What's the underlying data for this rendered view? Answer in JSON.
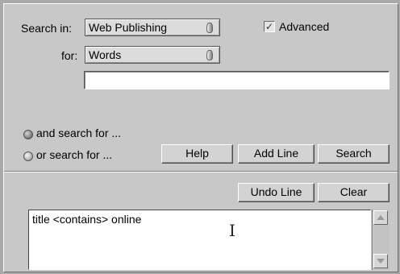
{
  "search": {
    "search_in_label": "Search in:",
    "search_in_value": "Web Publishing",
    "for_label": "for:",
    "for_value": "Words",
    "query_value": "",
    "advanced_label": "Advanced",
    "advanced_checked": true
  },
  "options": {
    "and_label": "and search for ...",
    "or_label": "or search for ..."
  },
  "buttons": {
    "help": "Help",
    "add_line": "Add Line",
    "search": "Search",
    "undo_line": "Undo Line",
    "clear": "Clear"
  },
  "query_text": "title <contains> online",
  "icons": {
    "text_cursor": "I-beam"
  }
}
